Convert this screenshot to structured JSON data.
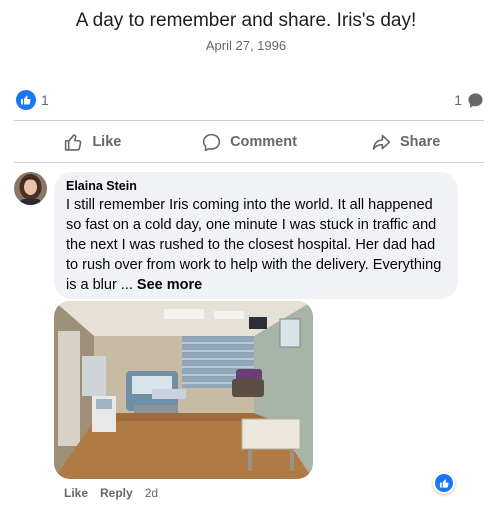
{
  "post": {
    "title": "A day to remember and share. Iris's day!",
    "date": "April 27, 1996"
  },
  "reactions": {
    "like_count": "1",
    "comment_count": "1"
  },
  "actions": {
    "like": "Like",
    "comment": "Comment",
    "share": "Share"
  },
  "comment": {
    "author": "Elaina Stein",
    "text": "I still remember Iris coming into the world. It all happened so fast on a cold day, one minute I was stuck in traffic and the next I was rushed to the closest hospital. Her dad had to rush over from work to help with the delivery. Everything is a blur ...",
    "see_more": "See more",
    "like_label": "Like",
    "reply_label": "Reply",
    "time": "2d"
  },
  "colors": {
    "accent": "#1877f2",
    "secondary_text": "#65676b",
    "bubble_bg": "#f0f2f5"
  },
  "icons": {
    "like_badge": "thumbs-up-icon",
    "comment_count": "speech-bubble-icon",
    "like_action": "thumbs-up-outline-icon",
    "comment_action": "speech-bubble-outline-icon",
    "share_action": "share-arrow-icon"
  }
}
